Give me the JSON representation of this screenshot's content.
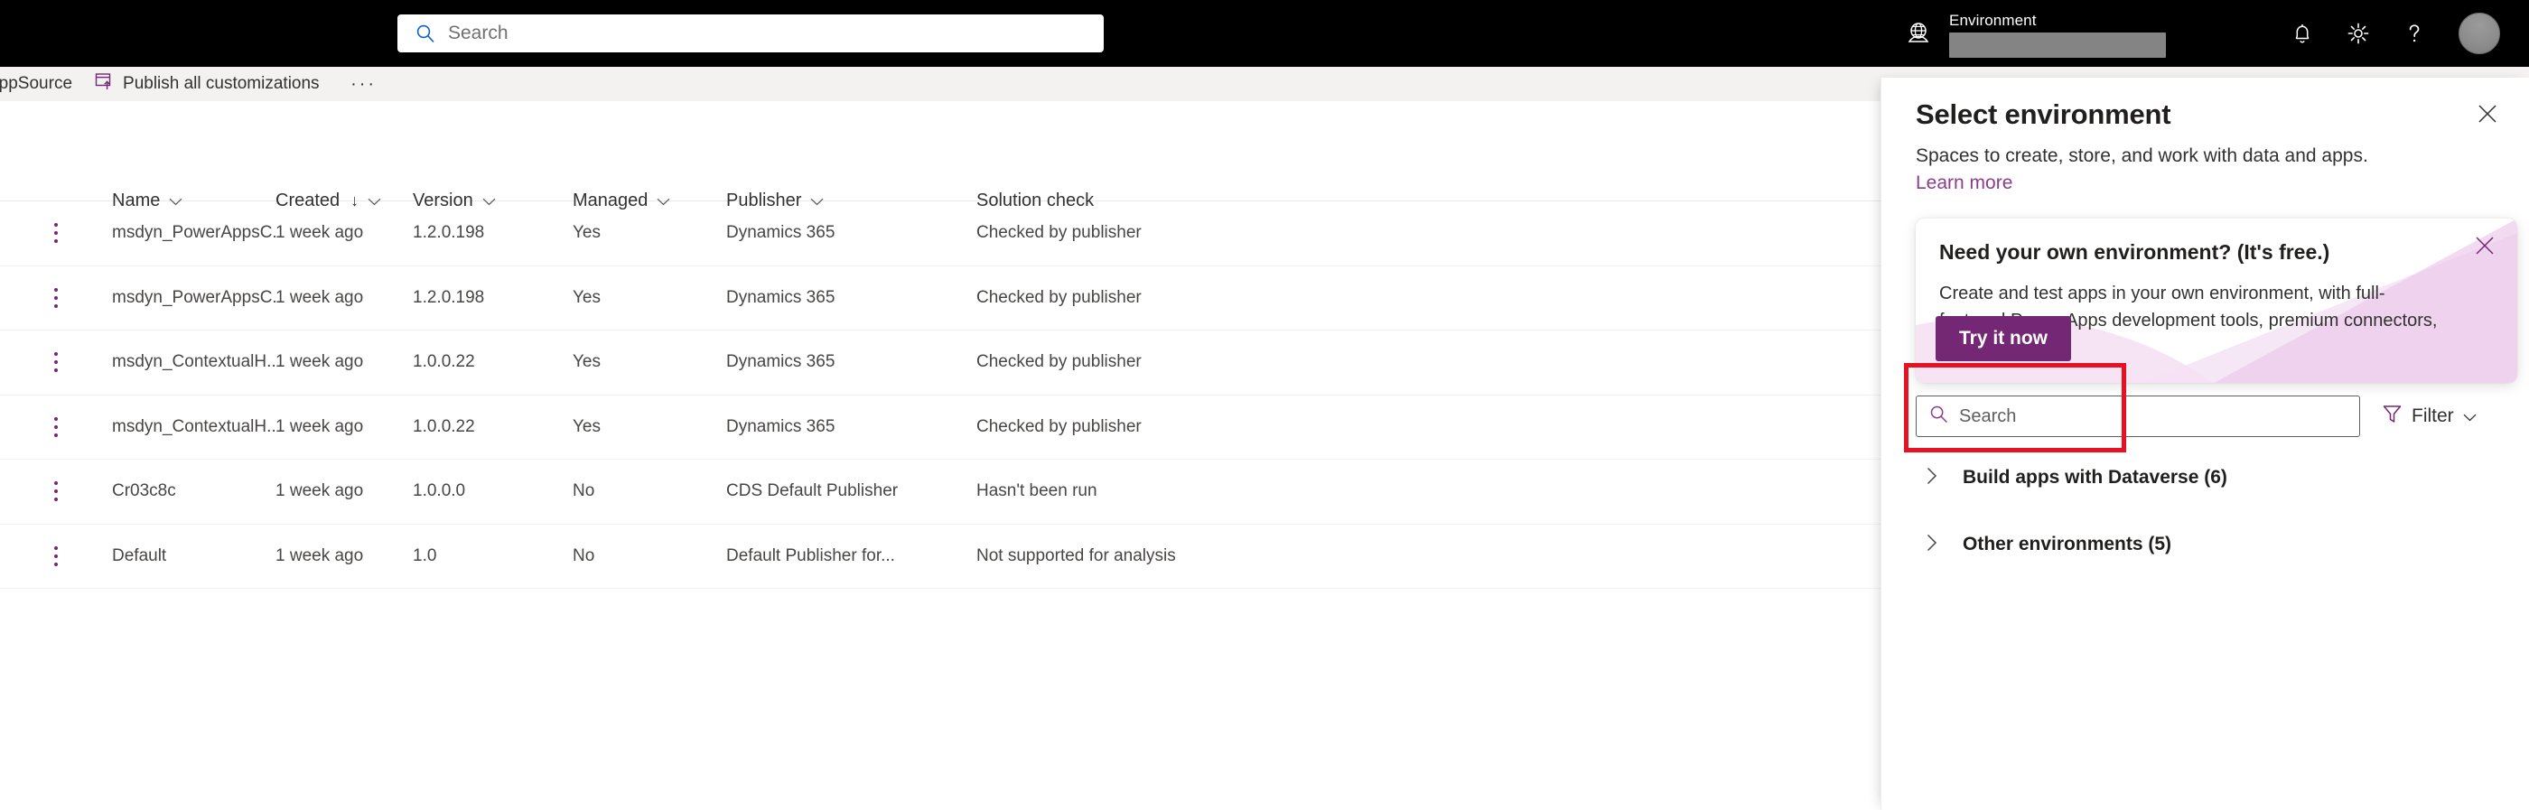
{
  "topbar": {
    "search": {
      "placeholder": "Search",
      "value": "",
      "icon": "search-icon"
    },
    "environment": {
      "label": "Environment",
      "value": "",
      "icon": "globe-icon"
    },
    "icons": {
      "notifications": "bell-icon",
      "settings": "gear-icon",
      "help": "question-mark-icon",
      "account": "avatar"
    }
  },
  "commandbar": {
    "items": [
      {
        "label": "AppSource",
        "icon": "appsource-icon"
      },
      {
        "label": "Publish all customizations",
        "icon": "publish-icon"
      }
    ],
    "overflow_label": "···"
  },
  "table": {
    "columns": [
      {
        "key": "name",
        "label": "Name",
        "sortable": true,
        "sorted": false
      },
      {
        "key": "created",
        "label": "Created",
        "sortable": true,
        "sorted": true,
        "sort_direction": "desc",
        "sort_glyph": "↓"
      },
      {
        "key": "version",
        "label": "Version",
        "sortable": true,
        "sorted": false
      },
      {
        "key": "managed",
        "label": "Managed",
        "sortable": true,
        "sorted": false
      },
      {
        "key": "publisher",
        "label": "Publisher",
        "sortable": true,
        "sorted": false
      },
      {
        "key": "solution_check",
        "label": "Solution check",
        "sortable": false,
        "sorted": false
      }
    ],
    "rows": [
      {
        "name": "msdyn_PowerAppsC...",
        "created": "1 week ago",
        "version": "1.2.0.198",
        "managed": "Yes",
        "publisher": "Dynamics 365",
        "solution_check": "Checked by publisher"
      },
      {
        "name": "msdyn_PowerAppsC...",
        "created": "1 week ago",
        "version": "1.2.0.198",
        "managed": "Yes",
        "publisher": "Dynamics 365",
        "solution_check": "Checked by publisher"
      },
      {
        "name": "msdyn_ContextualH...",
        "created": "1 week ago",
        "version": "1.0.0.22",
        "managed": "Yes",
        "publisher": "Dynamics 365",
        "solution_check": "Checked by publisher"
      },
      {
        "name": "msdyn_ContextualH...",
        "created": "1 week ago",
        "version": "1.0.0.22",
        "managed": "Yes",
        "publisher": "Dynamics 365",
        "solution_check": "Checked by publisher"
      },
      {
        "name": "Cr03c8c",
        "created": "1 week ago",
        "version": "1.0.0.0",
        "managed": "No",
        "publisher": "CDS Default Publisher",
        "solution_check": "Hasn't been run"
      },
      {
        "name": "Default",
        "created": "1 week ago",
        "version": "1.0",
        "managed": "No",
        "publisher": "Default Publisher for...",
        "solution_check": "Not supported for analysis"
      }
    ],
    "row_menu_icon": "kebab-menu-icon"
  },
  "panel": {
    "title": "Select environment",
    "subtitle": "Spaces to create, store, and work with data and apps.",
    "learn_more": "Learn more",
    "close_icon": "close-icon",
    "search": {
      "placeholder": "Search",
      "value": "",
      "icon": "search-icon"
    },
    "filter": {
      "label": "Filter",
      "icon": "filter-icon",
      "chevron": "chevron-down-icon"
    },
    "groups": [
      {
        "label": "Build apps with Dataverse (6)",
        "expanded": false,
        "chevron": "chevron-right-icon"
      },
      {
        "label": "Other environments (5)",
        "expanded": false,
        "chevron": "chevron-right-icon"
      }
    ]
  },
  "callout": {
    "title": "Need your own environment? (It's free.)",
    "body": "Create and test apps in your own environment, with full-featured Power Apps development tools, premium connectors, and Dataverse.",
    "button_label": "Try it now",
    "close_icon": "close-icon"
  },
  "colors": {
    "brand_purple": "#742774",
    "link_purple": "#8c3c8c",
    "highlight_red": "#e81123",
    "topbar_black": "#000000",
    "commandbar_gray": "#f3f2f1",
    "callout_wedge": "#f0d9ee"
  }
}
